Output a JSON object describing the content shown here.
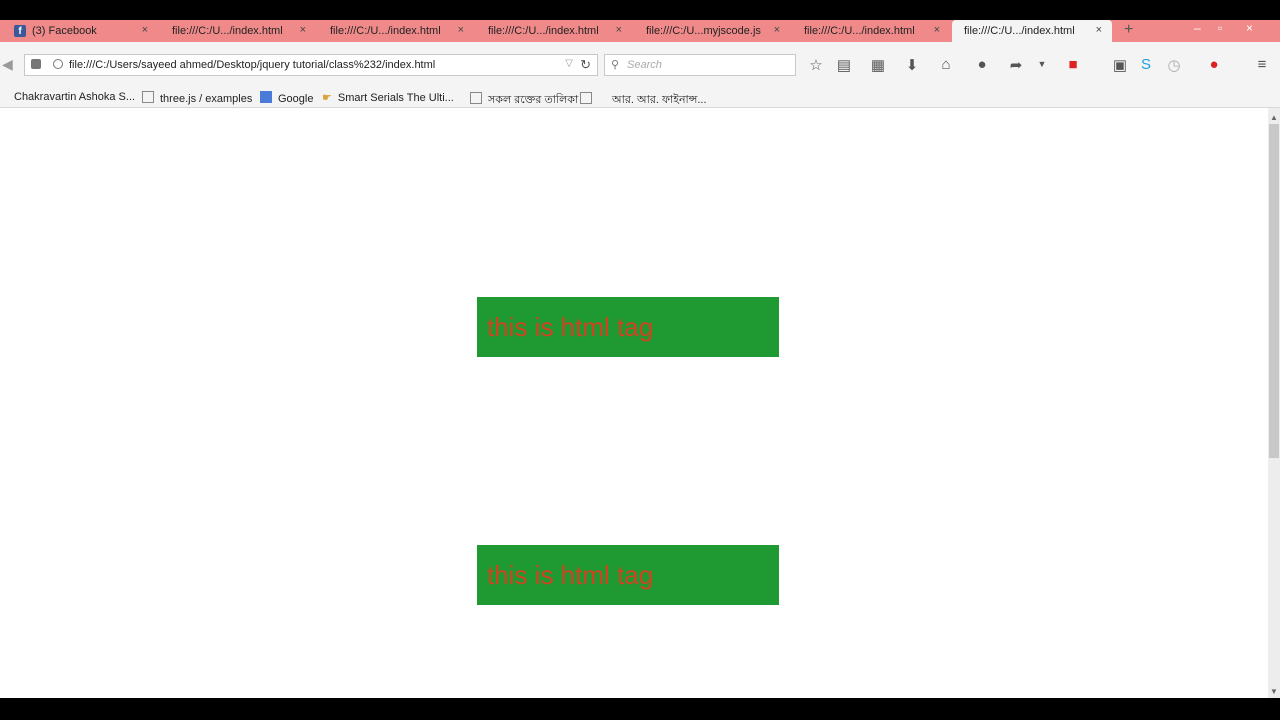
{
  "tabs": [
    {
      "label": "(3) Facebook",
      "active": false
    },
    {
      "label": "file:///C:/U.../index.html",
      "active": false
    },
    {
      "label": "file:///C:/U.../index.html",
      "active": false
    },
    {
      "label": "file:///C:/U.../index.html",
      "active": false
    },
    {
      "label": "file:///C:/U...myjscode.js",
      "active": false
    },
    {
      "label": "file:///C:/U.../index.html",
      "active": false
    },
    {
      "label": "file:///C:/U.../index.html",
      "active": true
    }
  ],
  "tab_close": "×",
  "new_tab": "+",
  "window_controls": {
    "minimize": "–",
    "restore": "▫",
    "close": "×"
  },
  "address": {
    "value": "file:///C:/Users/sayeed ahmed/Desktop/jquery tutorial/class%232/index.html"
  },
  "search": {
    "placeholder": "Search"
  },
  "bookmarks": [
    {
      "label": "Chakravartin Ashoka S..."
    },
    {
      "label": "three.js / examples"
    },
    {
      "label": "Google"
    },
    {
      "label": "Smart Serials The Ulti..."
    },
    {
      "label": "সকল রক্তের তালিকা"
    },
    {
      "label": "আর. আর. ফাইনান্স..."
    }
  ],
  "page": {
    "box1": "this is html tag",
    "box2": "this is html tag"
  },
  "colors": {
    "tabstrip": "#f08a8a",
    "box_bg": "#1f9a33",
    "box_text": "#cf4420"
  },
  "icons": [
    "back-icon",
    "lock-icon",
    "globe-icon",
    "reload-icon",
    "search-icon",
    "bookmark-star-icon",
    "clipboard-icon",
    "print-icon",
    "download-icon",
    "home-icon",
    "chat-icon",
    "share-icon",
    "add-on-icon",
    "youtube-icon",
    "skype-icon",
    "clock-icon",
    "menu-icon"
  ]
}
